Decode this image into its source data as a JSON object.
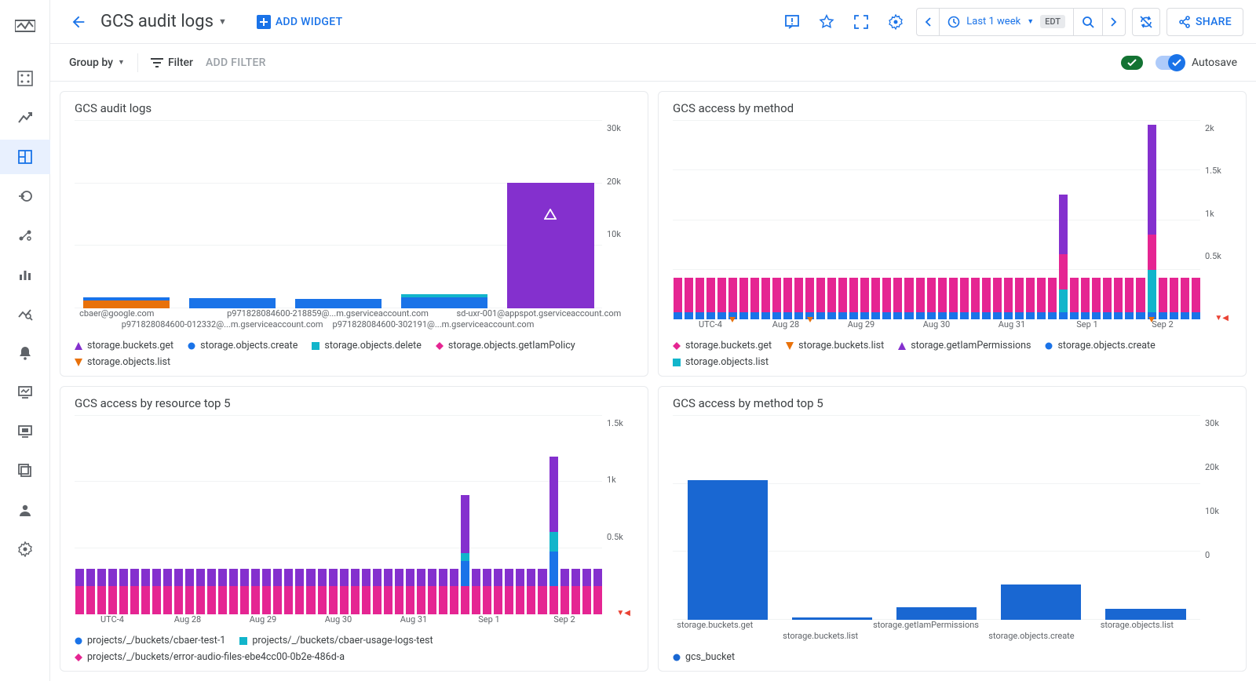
{
  "header": {
    "title": "GCS audit logs",
    "add_widget": "ADD WIDGET",
    "time_range": "Last 1 week",
    "tz_chip": "EDT",
    "share": "SHARE"
  },
  "toolbar": {
    "group_by": "Group by",
    "filter": "Filter",
    "add_filter": "ADD FILTER",
    "autosave": "Autosave"
  },
  "colors": {
    "purple": "#8430ce",
    "blue": "#1a73e8",
    "teal": "#12b5cb",
    "magenta": "#e52592",
    "orange": "#e8710a",
    "dblue": "#1967d2"
  },
  "cards": {
    "c1": {
      "title": "GCS audit logs"
    },
    "c2": {
      "title": "GCS access by method"
    },
    "c3": {
      "title": "GCS access by resource top 5"
    },
    "c4": {
      "title": "GCS access by method top 5"
    }
  },
  "legends": {
    "c1": [
      {
        "label": "storage.buckets.get",
        "shape": "tri",
        "color": "#8430ce"
      },
      {
        "label": "storage.objects.create",
        "shape": "circ",
        "color": "#1a73e8"
      },
      {
        "label": "storage.objects.delete",
        "shape": "sq",
        "color": "#12b5cb"
      },
      {
        "label": "storage.objects.getIamPolicy",
        "shape": "diam",
        "color": "#e52592"
      },
      {
        "label": "storage.objects.list",
        "shape": "tri-dn",
        "color": "#e8710a"
      }
    ],
    "c2": [
      {
        "label": "storage.buckets.get",
        "shape": "diam",
        "color": "#e52592"
      },
      {
        "label": "storage.buckets.list",
        "shape": "tri-dn",
        "color": "#e8710a"
      },
      {
        "label": "storage.getIamPermissions",
        "shape": "tri",
        "color": "#8430ce"
      },
      {
        "label": "storage.objects.create",
        "shape": "circ",
        "color": "#1a73e8"
      },
      {
        "label": "storage.objects.list",
        "shape": "sq",
        "color": "#12b5cb"
      }
    ],
    "c3": [
      {
        "label": "projects/_/buckets/cbaer-test-1",
        "shape": "circ",
        "color": "#1a73e8"
      },
      {
        "label": "projects/_/buckets/cbaer-usage-logs-test",
        "shape": "sq",
        "color": "#12b5cb"
      },
      {
        "label": "projects/_/buckets/error-audio-files-ebe4cc00-0b2e-486d-a",
        "shape": "diam",
        "color": "#e52592"
      }
    ],
    "c4": [
      {
        "label": "gcs_bucket",
        "shape": "circ",
        "color": "#1967d2"
      }
    ]
  },
  "chart_data": [
    {
      "id": "c1",
      "type": "bar",
      "stacked": true,
      "ylabel": "",
      "ylim": [
        0,
        30000
      ],
      "yticks": [
        "30k",
        "20k",
        "10k"
      ],
      "categories": [
        "cbaer@google.com",
        "p971828084600-012332@...m.gserviceaccount.com",
        "p971828084600-218859@...m.gserviceaccount.com",
        "p971828084600-302191@...m.gserviceaccount.com",
        "sd-uxr-001@appspot.gserviceaccount.com"
      ],
      "series": [
        {
          "name": "storage.objects.list",
          "color": "#e8710a",
          "values": [
            1200,
            0,
            0,
            0,
            0
          ]
        },
        {
          "name": "storage.objects.create",
          "color": "#1a73e8",
          "values": [
            600,
            1600,
            1500,
            1800,
            0
          ]
        },
        {
          "name": "storage.objects.delete",
          "color": "#12b5cb",
          "values": [
            0,
            0,
            0,
            400,
            0
          ]
        },
        {
          "name": "storage.buckets.get",
          "color": "#8430ce",
          "values": [
            0,
            0,
            0,
            0,
            20000
          ]
        }
      ]
    },
    {
      "id": "c2",
      "type": "bar",
      "stacked": true,
      "ylim": [
        0,
        2000
      ],
      "yticks": [
        "2k",
        "1.5k",
        "1k",
        "0.5k"
      ],
      "xlabel_left": "UTC-4",
      "categories": [
        "Aug 28",
        "Aug 29",
        "Aug 30",
        "Aug 31",
        "Sep 1",
        "Sep 2"
      ],
      "n_bars": 48,
      "base": {
        "create": 70,
        "get": 350
      },
      "spikes": [
        {
          "i": 35,
          "create": 70,
          "list": 230,
          "get": 350,
          "perm": 600
        },
        {
          "i": 43,
          "create": 70,
          "list": 430,
          "get": 350,
          "perm": 1100
        }
      ],
      "orange_marks": [
        5,
        12,
        43
      ]
    },
    {
      "id": "c3",
      "type": "bar",
      "stacked": true,
      "ylim": [
        0,
        1500
      ],
      "yticks": [
        "1.5k",
        "1k",
        "0.5k"
      ],
      "xlabel_left": "UTC-4",
      "categories": [
        "Aug 28",
        "Aug 29",
        "Aug 30",
        "Aug 31",
        "Sep 1",
        "Sep 2"
      ],
      "n_bars": 48,
      "base": {
        "magenta": 210,
        "purple": 130
      },
      "spikes": [
        {
          "i": 35,
          "magenta": 210,
          "blue": 190,
          "teal": 60,
          "purple": 440
        },
        {
          "i": 43,
          "magenta": 210,
          "blue": 260,
          "teal": 150,
          "purple": 570
        }
      ]
    },
    {
      "id": "c4",
      "type": "bar",
      "ylim": [
        0,
        30000
      ],
      "yticks": [
        "30k",
        "20k",
        "10k",
        "0"
      ],
      "categories": [
        "storage.buckets.get",
        "storage.buckets.list",
        "storage.getIamPermissions",
        "storage.objects.create",
        "storage.objects.list"
      ],
      "values": [
        20500,
        300,
        1800,
        5200,
        1600
      ]
    }
  ]
}
